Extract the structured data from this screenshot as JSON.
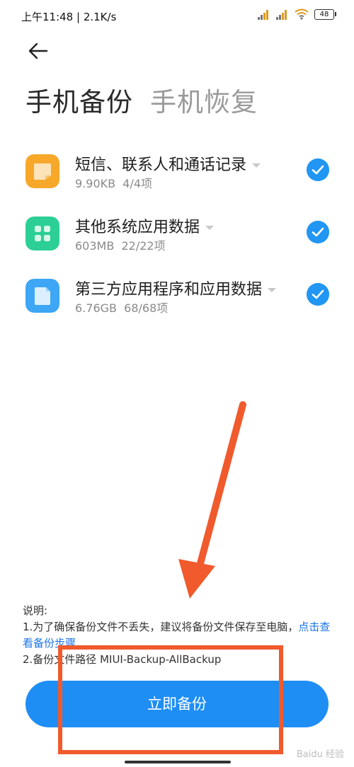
{
  "status_bar": {
    "time": "上午11:48 | 2.1K/s",
    "battery": "48"
  },
  "tabs": [
    {
      "label": "手机备份",
      "active": true
    },
    {
      "label": "手机恢复",
      "active": false
    }
  ],
  "items": [
    {
      "title": "短信、联系人和通话记录",
      "size": "9.90KB",
      "count": "4/4项",
      "icon": "message-icon",
      "color": "#f7a82a",
      "checked": true
    },
    {
      "title": "其他系统应用数据",
      "size": "603MB",
      "count": "22/22项",
      "icon": "apps-grid-icon",
      "color": "#2ccf95",
      "checked": true
    },
    {
      "title": "第三方应用程序和应用数据",
      "size": "6.76GB",
      "count": "68/68项",
      "icon": "file-icon",
      "color": "#3da6f5",
      "checked": true
    }
  ],
  "notes": {
    "heading": "说明:",
    "line1": "1.为了确保备份文件不丢失，建议将备份文件保存至电脑，",
    "line1_link": "点击查看备份步骤",
    "line2": "2.备份文件路径 MIUI-Backup-AllBackup"
  },
  "backup_button": "立即备份",
  "watermark": "Baidu 经验",
  "colors": {
    "accent": "#1e8ef5",
    "annotation": "#f05a2d"
  }
}
